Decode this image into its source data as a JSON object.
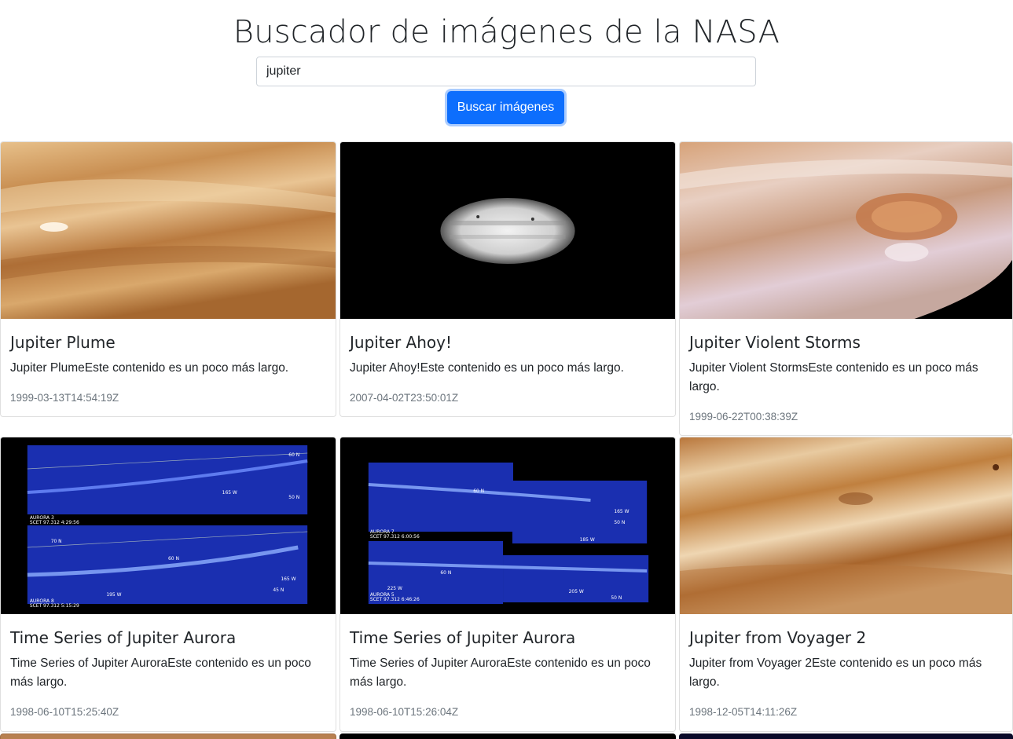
{
  "header": {
    "title": "Buscador de imágenes de la NASA"
  },
  "search": {
    "value": "jupiter",
    "button_label": "Buscar imágenes"
  },
  "cards": [
    {
      "title": "Jupiter Plume",
      "text": "Jupiter PlumeEste contenido es un poco más largo.",
      "date": "1999-03-13T14:54:19Z",
      "image": "jupiter-plume-image"
    },
    {
      "title": "Jupiter Ahoy!",
      "text": "Jupiter Ahoy!Este contenido es un poco más largo.",
      "date": "2007-04-02T23:50:01Z",
      "image": "jupiter-ahoy-image"
    },
    {
      "title": "Jupiter Violent Storms",
      "text": "Jupiter Violent StormsEste contenido es un poco más largo.",
      "date": "1999-06-22T00:38:39Z",
      "image": "jupiter-storms-image"
    },
    {
      "title": "Time Series of Jupiter Aurora",
      "text": "Time Series of Jupiter AuroraEste contenido es un poco más largo.",
      "date": "1998-06-10T15:25:40Z",
      "image": "aurora-image",
      "image_labels": [
        "60 N",
        "165 W",
        "50 N",
        "AURORA 3",
        "SCET 97.312 4:29:56",
        "70 N",
        "60 N",
        "165 W",
        "45 N",
        "195 W",
        "AURORA 8",
        "SCET 97.312 5:15:29"
      ]
    },
    {
      "title": "Time Series of Jupiter Aurora",
      "text": "Time Series of Jupiter AuroraEste contenido es un poco más largo.",
      "date": "1998-06-10T15:26:04Z",
      "image": "aurora-image",
      "image_labels": [
        "60 N",
        "165 W",
        "50 N",
        "AURORA 7",
        "SCET 97.312 6:00:56",
        "185 W",
        "60 N",
        "225 W",
        "205 W",
        "50 N",
        "AURORA 5",
        "SCET 97.312 6:46:26"
      ]
    },
    {
      "title": "Jupiter from Voyager 2",
      "text": "Jupiter from Voyager 2Este contenido es un poco más largo.",
      "date": "1998-12-05T14:11:26Z",
      "image": "jupiter-voyager-image"
    }
  ],
  "colors": {
    "primary": "#0d6efd",
    "muted": "#6c757d",
    "text": "#212529"
  }
}
